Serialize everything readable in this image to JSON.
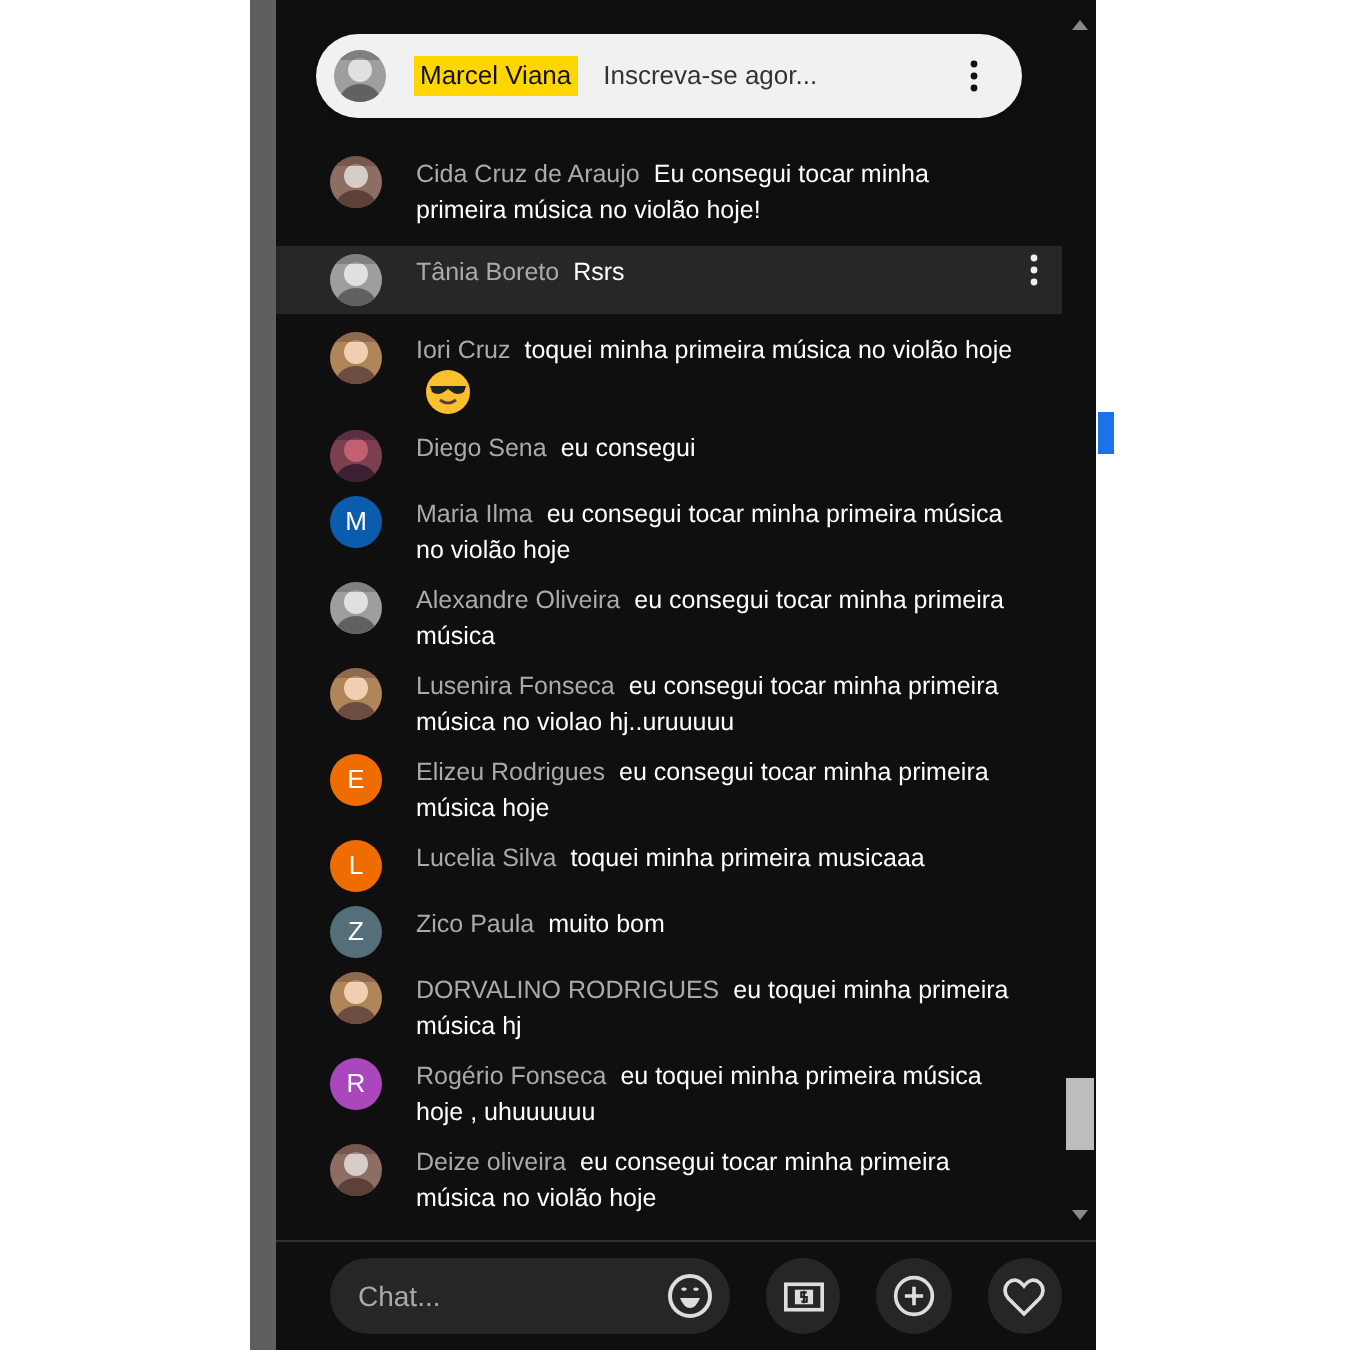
{
  "pinned": {
    "name": "Marcel Viana",
    "text": "Inscreva-se agor..."
  },
  "messages": [
    {
      "author": "Cida Cruz de Araujo",
      "text": "Eu consegui tocar minha primeira música no violão hoje!",
      "highlighted": false,
      "has_emoji": false
    },
    {
      "author": "Tânia Boreto",
      "text": "Rsrs",
      "highlighted": true,
      "has_emoji": false
    },
    {
      "author": "Iori Cruz",
      "text": "toquei minha primeira música no violão hoje",
      "highlighted": false,
      "has_emoji": true
    },
    {
      "author": "Diego Sena",
      "text": "eu consegui",
      "highlighted": false,
      "has_emoji": false
    },
    {
      "author": "Maria Ilma",
      "text": "eu consegui tocar minha primeira música no violão hoje",
      "avatar": {
        "kind": "letter",
        "letter": "M",
        "color": "#0b5cad"
      },
      "highlighted": false,
      "has_emoji": false
    },
    {
      "author": "Alexandre Oliveira",
      "text": "eu consegui tocar minha primeira música",
      "highlighted": false,
      "has_emoji": false
    },
    {
      "author": "Lusenira Fonseca",
      "text": "eu consegui tocar minha primeira música no violao hj..uruuuuu",
      "highlighted": false,
      "has_emoji": false
    },
    {
      "author": "Elizeu Rodrigues",
      "text": "eu consegui tocar minha primeira música hoje",
      "avatar": {
        "kind": "letter",
        "letter": "E",
        "color": "#ef6c00"
      },
      "highlighted": false,
      "has_emoji": false
    },
    {
      "author": "Lucelia Silva",
      "text": "toquei minha primeira musicaaa",
      "avatar": {
        "kind": "letter",
        "letter": "L",
        "color": "#ef6c00"
      },
      "highlighted": false,
      "has_emoji": false
    },
    {
      "author": "Zico Paula",
      "text": "muito bom",
      "avatar": {
        "kind": "letter",
        "letter": "Z",
        "color": "#546e7a"
      },
      "highlighted": false,
      "has_emoji": false
    },
    {
      "author": "DORVALINO RODRIGUES",
      "text": "eu toquei minha primeira música hj",
      "highlighted": false,
      "has_emoji": false
    },
    {
      "author": "Rogério Fonseca",
      "text": "eu toquei minha primeira música hoje , uhuuuuuu",
      "avatar": {
        "kind": "letter",
        "letter": "R",
        "color": "#ab47bc"
      },
      "highlighted": false,
      "has_emoji": false
    },
    {
      "author": "Deize oliveira",
      "text": "eu consegui tocar minha primeira música no violão hoje",
      "highlighted": false,
      "has_emoji": false
    }
  ],
  "chat_input": {
    "placeholder": "Chat..."
  }
}
